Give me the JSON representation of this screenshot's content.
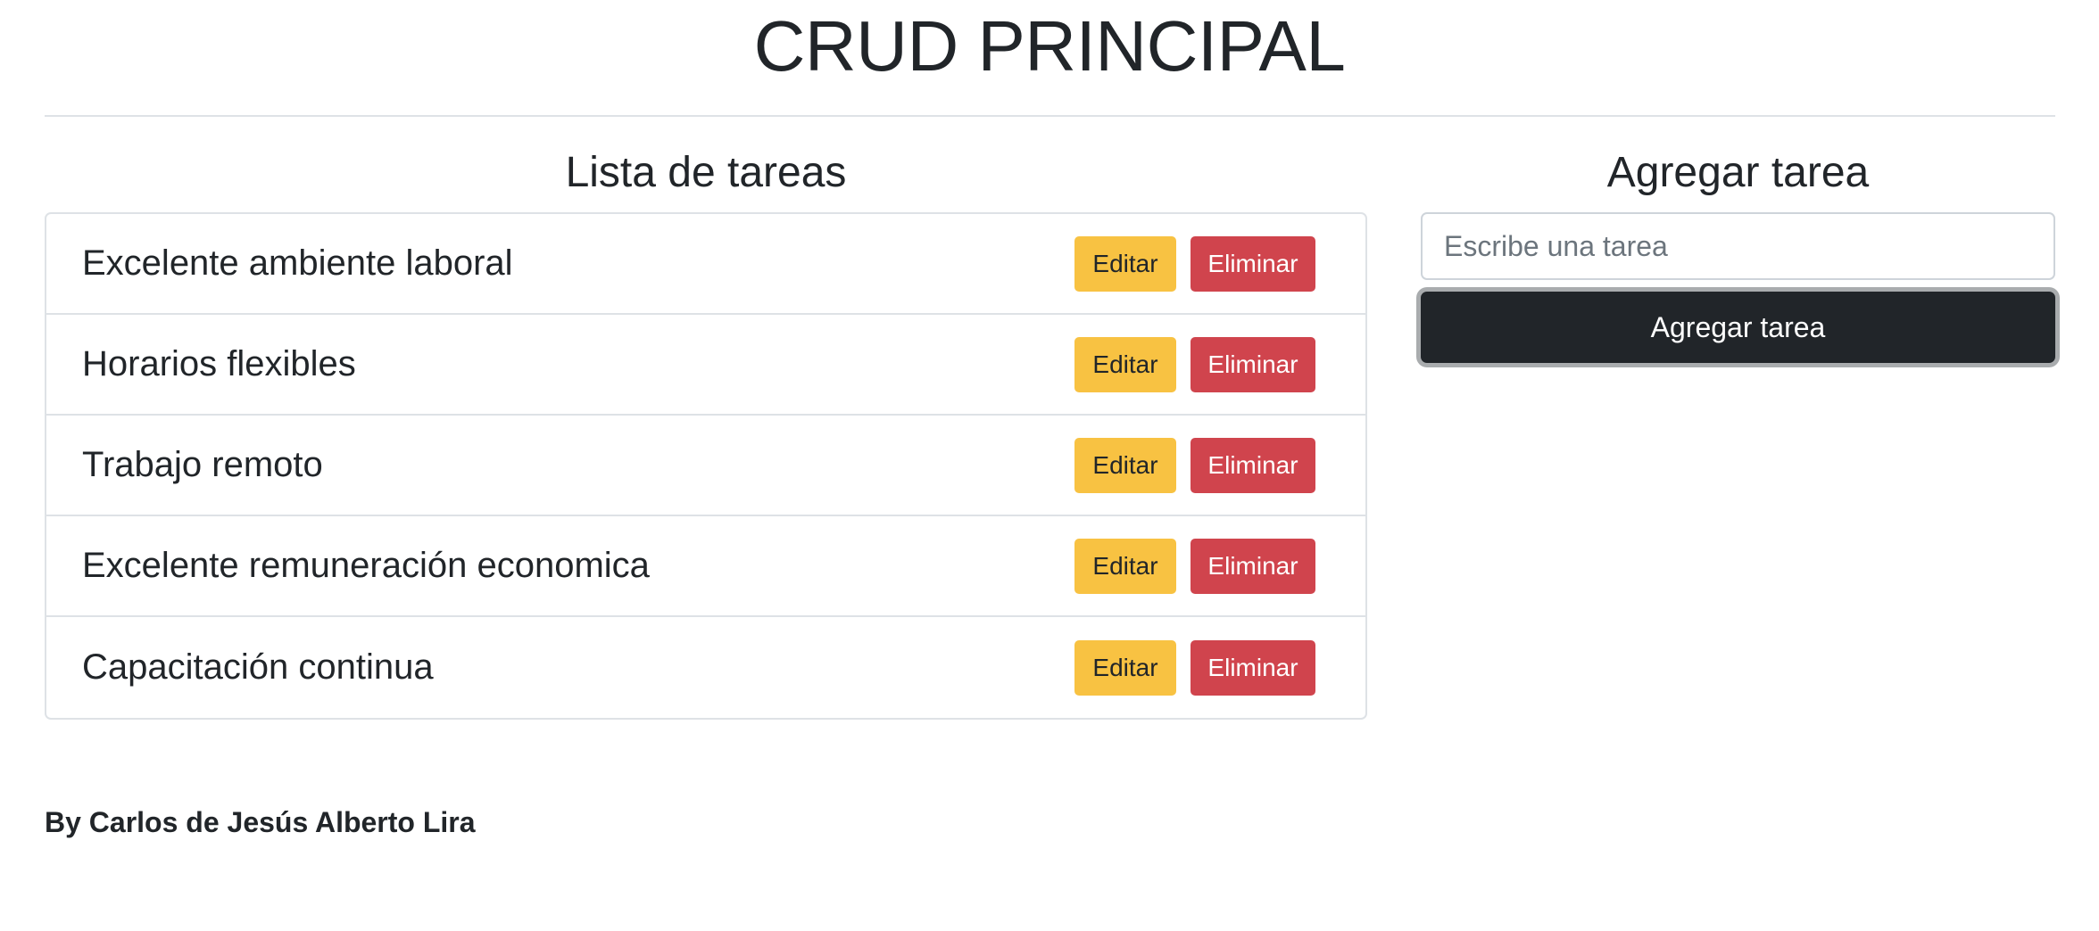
{
  "header": {
    "title": "CRUD PRINCIPAL"
  },
  "task_list": {
    "title": "Lista de tareas",
    "edit_label": "Editar",
    "delete_label": "Eliminar",
    "items": [
      "Excelente ambiente laboral",
      "Horarios flexibles",
      "Trabajo remoto",
      "Excelente remuneración economica",
      "Capacitación continua"
    ]
  },
  "add_form": {
    "title": "Agregar tarea",
    "input_value": "",
    "input_placeholder": "Escribe una tarea",
    "submit_label": "Agregar tarea"
  },
  "footer": {
    "credit": "By Carlos de Jesús Alberto Lira"
  },
  "colors": {
    "edit_button": "#f8c242",
    "delete_button": "#d0444d",
    "primary_dark": "#212529",
    "border": "#dee2e6"
  }
}
